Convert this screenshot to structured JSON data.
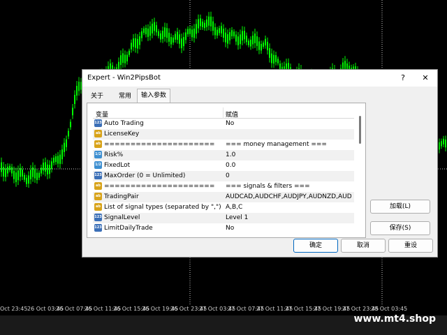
{
  "chart": {
    "time_labels": [
      "Oct 23:45",
      "26 Oct 03:45",
      "26 Oct 07:45",
      "26 Oct 11:45",
      "26 Oct 15:45",
      "26 Oct 19:45",
      "26 Oct 23:45",
      "27 Oct 03:45",
      "27 Oct 07:45",
      "27 Oct 11:45",
      "27 Oct 15:45",
      "27 Oct 19:45",
      "27 Oct 23:45",
      "28 Oct 03:45"
    ],
    "candle_color": "#00ff00",
    "watermark": "www.mt4.shop"
  },
  "dialog": {
    "title": "Expert - Win2PipsBot",
    "help_label": "?",
    "close_label": "✕",
    "tabs": [
      "关于",
      "常用",
      "输入参数"
    ],
    "active_tab": 2,
    "headers": {
      "variable": "变量",
      "value": "赋值"
    },
    "params": [
      {
        "type": "b123",
        "badge": "123",
        "name": "Auto Trading",
        "value": "No"
      },
      {
        "type": "ab",
        "badge": "ab",
        "name": "LicenseKey",
        "value": ""
      },
      {
        "type": "ab",
        "badge": "ab",
        "name": "=====================",
        "value": "=== money management ==="
      },
      {
        "type": "b12",
        "badge": "1/2",
        "name": "Risk%",
        "value": "1.0"
      },
      {
        "type": "b12",
        "badge": "1/2",
        "name": "FixedLot",
        "value": "0.0"
      },
      {
        "type": "b123",
        "badge": "123",
        "name": "MaxOrder (0 = Unlimited)",
        "value": "0"
      },
      {
        "type": "ab",
        "badge": "ab",
        "name": "=====================",
        "value": "=== signals & filters ==="
      },
      {
        "type": "ab",
        "badge": "ab",
        "name": "TradingPair",
        "value": "AUDCAD,AUDCHF,AUDJPY,AUDNZD,AUD..."
      },
      {
        "type": "ab",
        "badge": "ab",
        "name": "List of signal types (separated by \",\")",
        "value": "A,B,C"
      },
      {
        "type": "b123",
        "badge": "123",
        "name": "SignalLevel",
        "value": "Level 1"
      },
      {
        "type": "b123",
        "badge": "123",
        "name": "LimitDailyTrade",
        "value": "No"
      }
    ],
    "buttons": {
      "load": "加载(L)",
      "save": "保存(S)",
      "ok": "确定",
      "cancel": "取消",
      "reset": "重设"
    }
  }
}
